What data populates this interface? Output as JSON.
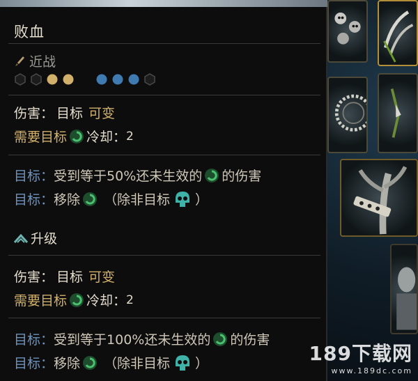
{
  "skill": {
    "name": "败血",
    "type": "近战",
    "positions": [
      "empty",
      "empty",
      "gold",
      "gold"
    ],
    "targets": [
      "blue",
      "blue",
      "blue",
      "empty"
    ],
    "colors": {
      "gold": "#d0b06a",
      "blue": "#3f7ab0",
      "empty": "#2c2c2c"
    }
  },
  "base": {
    "damage_label": "伤害：",
    "damage_target": "目标",
    "damage_value": "可变",
    "requires_label": "需要目标",
    "cooldown_label": "冷却：",
    "cooldown_value": "2",
    "effect1_prefix": "目标：",
    "effect1_text": "受到等于50%还未生效的",
    "effect1_suffix": "的伤害",
    "effect2_prefix": "目标：",
    "effect2_text": "移除",
    "effect2_mid": "（除非目标",
    "effect2_end": "）"
  },
  "upgrade": {
    "label": "升级",
    "damage_label": "伤害：",
    "damage_target": "目标",
    "damage_value": "可变",
    "requires_label": "需要目标",
    "cooldown_label": "冷却：",
    "cooldown_value": "2",
    "effect1_prefix": "目标：",
    "effect1_text": "受到等于100%还未生效的",
    "effect1_suffix": "的伤害",
    "effect2_prefix": "目标：",
    "effect2_text": "移除",
    "effect2_mid": "（除非目标",
    "effect2_end": "）"
  },
  "watermark": {
    "main": "189下载网",
    "sub": "www.189dc.com"
  },
  "icons": {
    "type": "dagger-icon",
    "mark": "blight-mark-icon",
    "exception": "skull-icon",
    "upgrade": "upgrade-chevron-icon"
  }
}
